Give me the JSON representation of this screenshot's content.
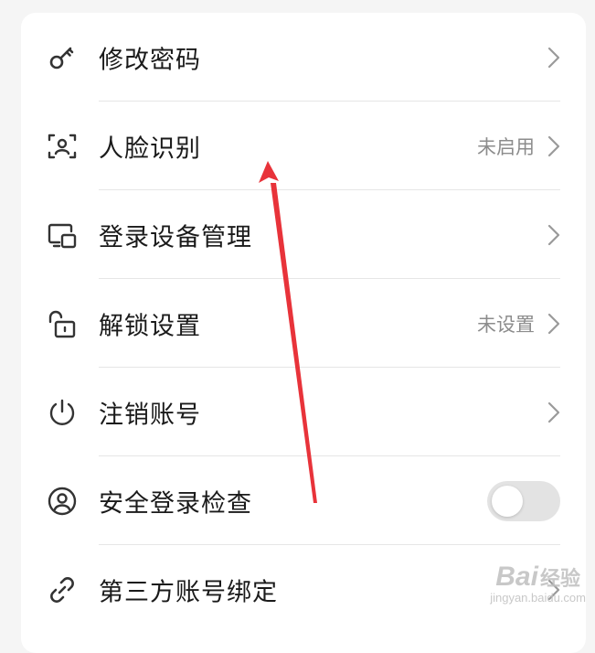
{
  "settings": {
    "items": [
      {
        "label": "修改密码",
        "icon": "key-icon",
        "status": "",
        "control": "chevron"
      },
      {
        "label": "人脸识别",
        "icon": "face-scan-icon",
        "status": "未启用",
        "control": "chevron"
      },
      {
        "label": "登录设备管理",
        "icon": "devices-icon",
        "status": "",
        "control": "chevron"
      },
      {
        "label": "解锁设置",
        "icon": "unlock-icon",
        "status": "未设置",
        "control": "chevron"
      },
      {
        "label": "注销账号",
        "icon": "power-icon",
        "status": "",
        "control": "chevron"
      },
      {
        "label": "安全登录检查",
        "icon": "user-circle-icon",
        "status": "",
        "control": "toggle",
        "toggle_on": false
      },
      {
        "label": "第三方账号绑定",
        "icon": "link-icon",
        "status": "",
        "control": "chevron"
      }
    ]
  },
  "annotation": {
    "color": "#e8333a",
    "type": "arrow",
    "points_to": "人脸识别"
  },
  "watermark": {
    "main": "Bai",
    "sub": "经验",
    "url": "jingyan.baidu.com"
  },
  "colors": {
    "text": "#1a1a1a",
    "secondary": "#8c8c8c",
    "icon": "#333333",
    "toggle_off": "#e3e3e3"
  }
}
